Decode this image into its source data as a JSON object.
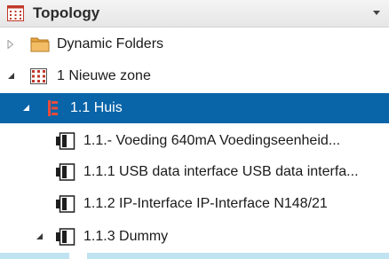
{
  "panel": {
    "title": "Topology",
    "title_icon": "topology-icon",
    "menu_icon": "chevron-down-icon"
  },
  "tree": {
    "items": [
      {
        "label": "Dynamic Folders",
        "icon": "folder-icon",
        "expander": "collapsed"
      },
      {
        "label": "1 Nieuwe zone",
        "icon": "zone-icon",
        "expander": "expanded"
      },
      {
        "label": "1.1 Huis",
        "icon": "building-icon",
        "expander": "expanded",
        "selected": true
      },
      {
        "label": "1.1.- Voeding 640mA Voedingseenheid...",
        "icon": "device-icon"
      },
      {
        "label": "1.1.1 USB data interface USB data interfa...",
        "icon": "device-icon"
      },
      {
        "label": "1.1.2 IP-Interface IP-Interface N148/21",
        "icon": "device-icon"
      },
      {
        "label": "1.1.3 Dummy",
        "icon": "device-icon",
        "expander": "expanded"
      }
    ]
  },
  "colors": {
    "selection": "#0a64a8",
    "zone_accent": "#c0392b",
    "folder": "#e8a33d",
    "bottom_strip": "#bfe3f1"
  }
}
